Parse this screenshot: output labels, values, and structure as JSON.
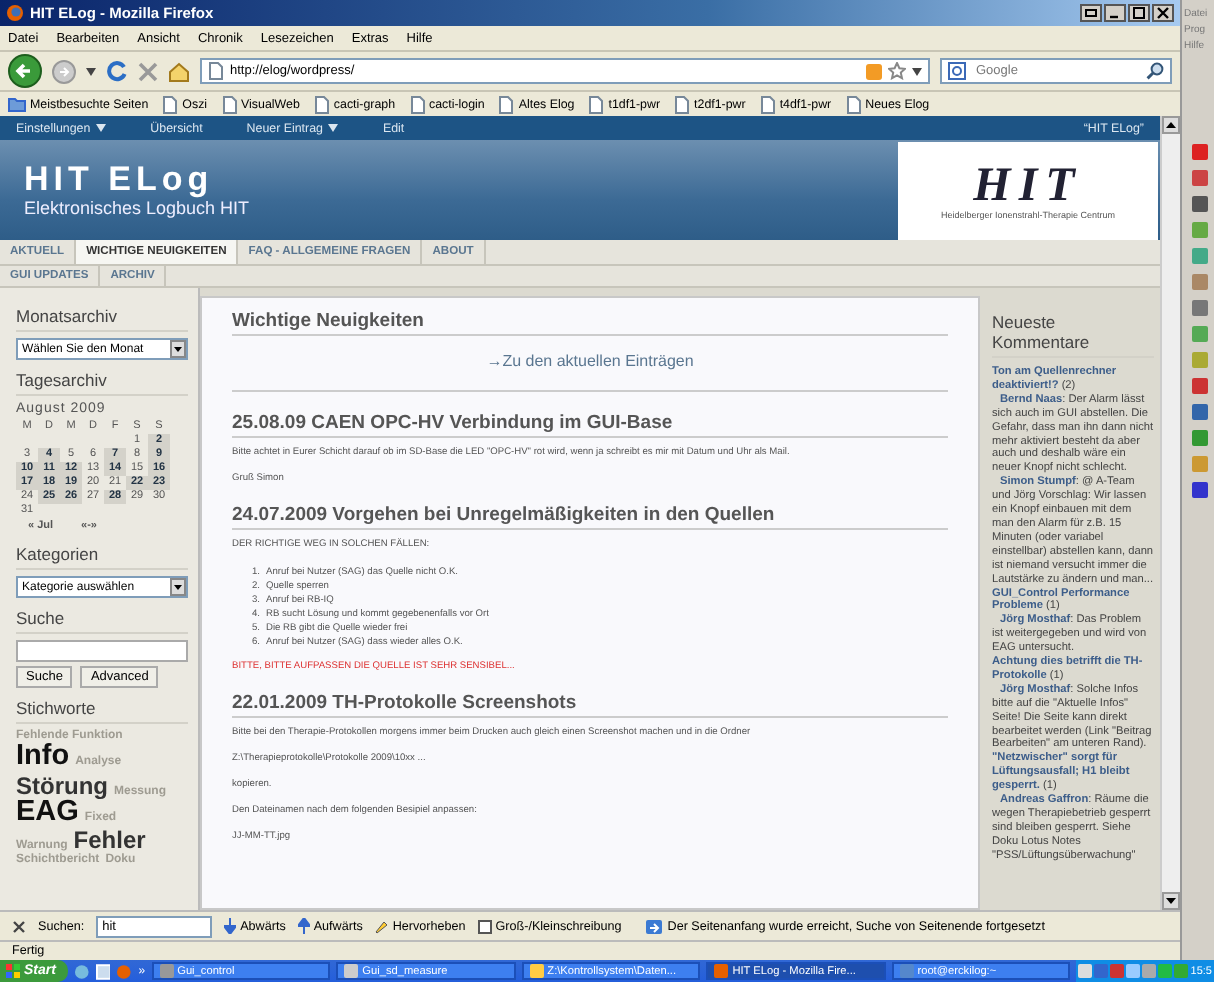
{
  "window": {
    "title": "HIT ELog - Mozilla Firefox"
  },
  "menu": [
    "Datei",
    "Bearbeiten",
    "Ansicht",
    "Chronik",
    "Lesezeichen",
    "Extras",
    "Hilfe"
  ],
  "toolbar": {
    "url": "http://elog/wordpress/",
    "search_placeholder": "Google"
  },
  "bookmarks": [
    "Meistbesuchte Seiten",
    "Oszi",
    "VisualWeb",
    "cacti-graph",
    "cacti-login",
    "Altes Elog",
    "t1df1-pwr",
    "t2df1-pwr",
    "t4df1-pwr",
    "Neues Elog"
  ],
  "admin_bar": {
    "items": [
      {
        "label": "Einstellungen",
        "dropdown": true
      },
      {
        "label": "Übersicht",
        "dropdown": false
      },
      {
        "label": "Neuer Eintrag",
        "dropdown": true
      },
      {
        "label": "Edit",
        "dropdown": false
      }
    ],
    "site": "“HIT ELog”"
  },
  "header": {
    "title": "HIT ELog",
    "subtitle": "Elektronisches Logbuch HIT",
    "logo": "HIT",
    "logo_caption": "Heidelberger Ionenstrahl-Therapie Centrum"
  },
  "nav": [
    [
      {
        "label": "AKTUELL",
        "selected": false
      },
      {
        "label": "WICHTIGE NEUIGKEITEN",
        "selected": true
      },
      {
        "label": "FAQ - ALLGEMEINE FRAGEN",
        "selected": false
      },
      {
        "label": "ABOUT",
        "selected": false
      }
    ],
    [
      {
        "label": "GUI UPDATES",
        "selected": false
      },
      {
        "label": "ARCHIV",
        "selected": false
      }
    ]
  ],
  "sidebar": {
    "month_archive": {
      "heading": "Monatsarchiv",
      "select": "Wählen Sie den Monat"
    },
    "calendar": {
      "heading": "Tagesarchiv",
      "month": "August 2009",
      "weekdays": [
        "M",
        "D",
        "M",
        "D",
        "F",
        "S",
        "S"
      ],
      "weeks": [
        {
          "kind": "end",
          "days": [
            {
              "day": "1",
              "linked": false
            },
            {
              "day": "2",
              "linked": true
            }
          ]
        },
        {
          "kind": "start",
          "days": [
            {
              "day": "3",
              "linked": false
            },
            {
              "day": "4",
              "linked": true
            },
            {
              "day": "5",
              "linked": false
            },
            {
              "day": "6",
              "linked": false
            },
            {
              "day": "7",
              "linked": true
            },
            {
              "day": "8",
              "linked": false
            },
            {
              "day": "9",
              "linked": true
            }
          ]
        },
        {
          "kind": "start",
          "days": [
            {
              "day": "10",
              "linked": true
            },
            {
              "day": "11",
              "linked": true
            },
            {
              "day": "12",
              "linked": true
            },
            {
              "day": "13",
              "linked": false
            },
            {
              "day": "14",
              "linked": true
            },
            {
              "day": "15",
              "linked": false
            },
            {
              "day": "16",
              "linked": true
            }
          ]
        },
        {
          "kind": "start",
          "days": [
            {
              "day": "17",
              "linked": true
            },
            {
              "day": "18",
              "linked": true
            },
            {
              "day": "19",
              "linked": true
            },
            {
              "day": "20",
              "linked": false
            },
            {
              "day": "21",
              "linked": false
            },
            {
              "day": "22",
              "linked": true
            },
            {
              "day": "23",
              "linked": true
            }
          ]
        },
        {
          "kind": "start",
          "days": [
            {
              "day": "24",
              "linked": false
            },
            {
              "day": "25",
              "linked": true
            },
            {
              "day": "26",
              "linked": true
            },
            {
              "day": "27",
              "linked": false
            },
            {
              "day": "28",
              "linked": true
            },
            {
              "day": "29",
              "linked": false
            },
            {
              "day": "30",
              "linked": false
            }
          ]
        },
        {
          "kind": "start",
          "days": [
            {
              "day": "31",
              "linked": false
            }
          ]
        }
      ],
      "prev": "« Jul",
      "next": "«-»"
    },
    "categories": {
      "heading": "Kategorien",
      "select": "Kategorie auswählen"
    },
    "search": {
      "heading": "Suche",
      "buttons": [
        "Suche",
        "Advanced"
      ]
    },
    "tags": {
      "heading": "Stichworte",
      "rows": [
        [
          {
            "label": "Fehlende Funktion",
            "kind": "small"
          }
        ],
        [
          {
            "label": "Info",
            "kind": "large"
          },
          {
            "label": "Analyse",
            "kind": "small"
          }
        ],
        [
          {
            "label": "Störung",
            "kind": "medium"
          },
          {
            "label": "Messung",
            "kind": "small"
          }
        ],
        [
          {
            "label": "EAG",
            "kind": "large"
          },
          {
            "label": "Fixed",
            "kind": "small"
          }
        ],
        [
          {
            "label": "Warnung",
            "kind": "small"
          },
          {
            "label": "Fehler",
            "kind": "medium"
          }
        ],
        [
          {
            "label": "Schichtbericht",
            "kind": "small"
          },
          {
            "label": "Doku",
            "kind": "small"
          }
        ]
      ]
    }
  },
  "main": {
    "heading": "Wichtige Neuigkeiten",
    "link": "→Zu den aktuellen Einträgen",
    "posts": [
      {
        "title": "25.08.09 CAEN OPC-HV Verbindung im GUI-Base",
        "blocks": [
          {
            "kind": "text",
            "text": "Bitte achtet in Eurer Schicht darauf ob im SD-Base die LED \"OPC-HV\" rot wird, wenn ja schreibt es mir mit Datum und Uhr als Mail."
          },
          {
            "kind": "text",
            "text": "Gruß Simon"
          }
        ]
      },
      {
        "title": "24.07.2009 Vorgehen bei Unregelmäßigkeiten in den Quellen",
        "blocks": [
          {
            "kind": "text",
            "text": "DER RICHTIGE WEG IN SOLCHEN FÄLLEN:"
          },
          {
            "kind": "list",
            "items": [
              {
                "marker": "1.",
                "text": "Anruf bei Nutzer (SAG) das Quelle nicht O.K."
              },
              {
                "marker": "2.",
                "text": "Quelle sperren"
              },
              {
                "marker": "3.",
                "text": "Anruf bei RB-IQ"
              },
              {
                "marker": "4.",
                "text": "RB sucht Lösung und kommt gegebenenfalls vor Ort"
              },
              {
                "marker": "5.",
                "text": "Die RB gibt die Quelle wieder frei"
              },
              {
                "marker": "6.",
                "text": "Anruf bei Nutzer (SAG) dass wieder alles O.K."
              }
            ]
          },
          {
            "kind": "alert",
            "text": "BITTE, BITTE AUFPASSEN DIE QUELLE IST SEHR SENSIBEL..."
          }
        ]
      },
      {
        "title": "22.01.2009 TH-Protokolle Screenshots",
        "blocks": [
          {
            "kind": "text",
            "text": "Bitte bei den Therapie-Protokollen morgens immer beim Drucken auch gleich einen Screenshot machen und in die Ordner"
          },
          {
            "kind": "text",
            "text": "Z:\\Therapieprotokolle\\Protokolle 2009\\10xx ..."
          },
          {
            "kind": "text",
            "text": "kopieren."
          },
          {
            "kind": "text",
            "text": "Den Dateinamen nach dem folgenden Besipiel anpassen:"
          },
          {
            "kind": "text",
            "text": "JJ-MM-TT.jpg"
          }
        ]
      }
    ]
  },
  "comments": {
    "heading": "Neueste Kommentare",
    "items": [
      {
        "kind": "post",
        "text": "**Ton am Quellenrechner deaktiviert!?** (2)"
      },
      {
        "kind": "comment",
        "text": "**Bernd Naas**: Der Alarm lässt sich auch im GUI abstellen. Die Gefahr, dass man ihn dann nicht mehr aktiviert besteht da aber auch und deshalb wäre ein neuer Knopf nicht schlecht."
      },
      {
        "kind": "comment",
        "text": "**Simon Stumpf**: @ A-Team und Jörg Vorschlag: Wir lassen ein Knopf einbauen mit dem man den Alarm für z.B. 15 Minuten (oder variabel einstellbar) abstellen kann, dann ist niemand versucht immer die Lautstärke zu ändern und man..."
      },
      {
        "kind": "post",
        "text": "**GUI_Control Performance Probleme** (1)"
      },
      {
        "kind": "comment",
        "text": "**Jörg Mosthaf**: Das Problem ist weitergegeben und wird von EAG untersucht."
      },
      {
        "kind": "post",
        "text": "**Achtung dies betrifft die TH-Protokolle** (1)"
      },
      {
        "kind": "comment",
        "text": "**Jörg Mosthaf**: Solche Infos bitte auf die \"Aktuelle Infos\" Seite! Die Seite kann direkt bearbeitet werden (Link \"Beitrag Bearbeiten\" am unteren Rand)."
      },
      {
        "kind": "post",
        "text": "**\"Netzwischer\" sorgt für Lüftungsausfall; H1 bleibt gesperrt.** (1)"
      },
      {
        "kind": "comment",
        "text": "**Andreas Gaffron**: Räume die wegen Therapiebetrieb gesperrt sind bleiben gesperrt. Siehe Doku Lotus Notes \"PSS/Lüftungsüberwachung\""
      }
    ]
  },
  "find_bar": {
    "label": "Suchen:",
    "value": "hit",
    "buttons": [
      "Abwärts",
      "Aufwärts",
      "Hervorheben"
    ],
    "match_case": {
      "label": "Groß-/Kleinschreibung",
      "checked": false
    },
    "message": "Der Seitenanfang wurde erreicht, Suche von Seitenende fortgesetzt"
  },
  "status_bar": "Fertig",
  "taskbar": {
    "start": "Start",
    "more": "»",
    "tasks": [
      {
        "label": "Gui_control",
        "selected": false
      },
      {
        "label": "Gui_sd_measure",
        "selected": false
      },
      {
        "label": "Z:\\Kontrollsystem\\Daten...",
        "selected": false
      },
      {
        "label": "HIT ELog - Mozilla Fire...",
        "selected": true
      },
      {
        "label": "root@erckilog:~",
        "selected": false
      }
    ],
    "clock": "15:5"
  },
  "side_app": {
    "menu": [
      "Datei",
      "Prog",
      "Hilfe"
    ]
  }
}
